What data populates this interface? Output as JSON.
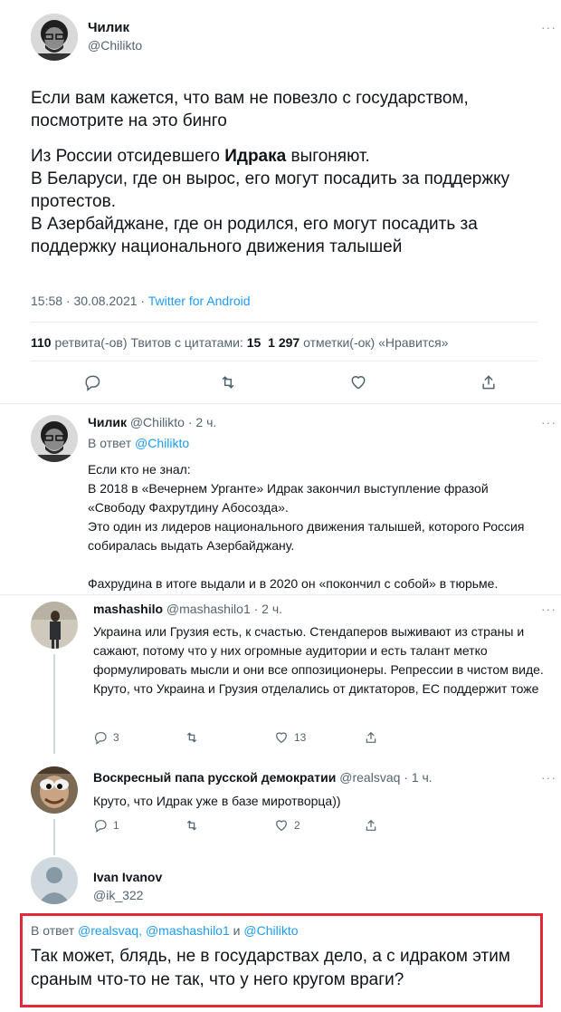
{
  "main_tweet": {
    "name": "Чилик",
    "handle": "@Chilikto",
    "text_p1": "Если вам кажется, что вам не повезло с государством, посмотрите на это бинго",
    "line1_a": "Из России отсидевшего ",
    "line1_bold": "Идрака",
    "line1_b": " выгоняют.",
    "line2": "В Беларуси, где он вырос, его могут посадить за поддержку протестов.",
    "line3": "В Азербайджане, где он родился, его могут посадить за поддержку национального движения талышей",
    "time": "15:58 · 30.08.2021 · ",
    "source": "Twitter for Android",
    "retweets": "110",
    "retweets_label": " ретвита(-ов) ",
    "quotes_label": "Твитов с цитатами: ",
    "quotes": "15",
    "likes": "1 297",
    "likes_label": " отметки(-ок) «Нравится»"
  },
  "reply1": {
    "name": "Чилик",
    "meta": "@Chilikto · 2 ч.",
    "reply_to_prefix": "В ответ ",
    "reply_to": "@Chilikto",
    "line1": "Если кто не знал:",
    "line2": "В 2018 в «Вечернем Урганте» Идрак закончил выступление фразой «Свободу Фахрутдину Абосозда».",
    "line3": "Это один из лидеров национального движения талышей, которого Россия собиралась выдать Азербайджану.",
    "line4": "Фахрудина в итоге выдали и в 2020 он «покончил с собой» в тюрьме."
  },
  "reply2": {
    "name": "mashashilo",
    "meta": "@mashashilo1 · 2 ч.",
    "text": "Украина или Грузия есть, к счастью. Стендаперов выживают из страны и сажают, потому что у них огромные аудитории и есть талант метко формулировать мысли и они все оппозиционеры. Репрессии в чистом виде. Круто, что Украина и Грузия отделались от диктаторов, ЕС поддержит тоже",
    "replies": "3",
    "likes": "13"
  },
  "reply3": {
    "name": "Воскресный папа русской демократии",
    "meta": "@realsvaq · 1 ч.",
    "text": "Круто, что Идрак уже в базе миротворца))",
    "replies": "1",
    "likes": "2"
  },
  "reply4": {
    "name": "Ivan Ivanov",
    "handle": "@ik_322",
    "reply_prefix": "В ответ ",
    "reply_users": "@realsvaq, @mashashilo1",
    "reply_and": " и ",
    "reply_user3": "@Chilikto",
    "text": "Так может, блядь, не в государствах дело, а с идраком этим сраным что-то не так, что у него кругом враги?"
  },
  "colors": {
    "accent": "#1d9bf0",
    "highlight_border": "#e02a3a"
  }
}
